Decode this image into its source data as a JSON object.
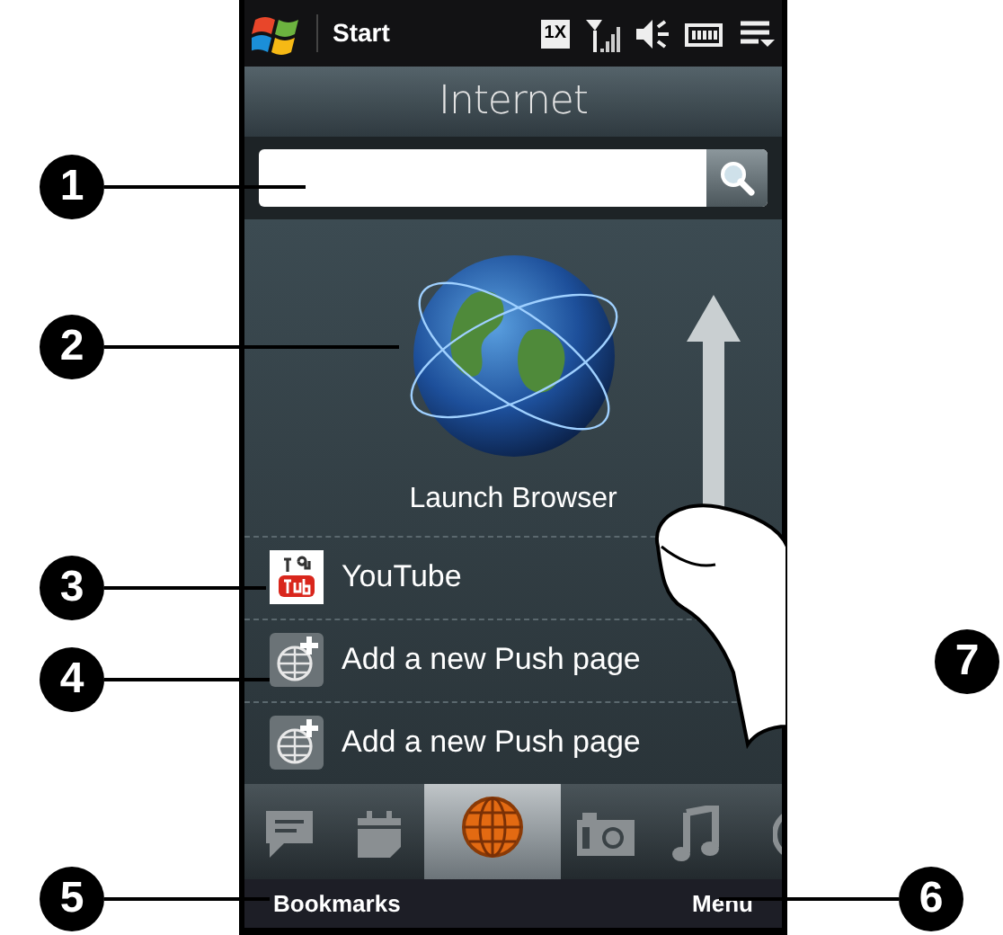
{
  "status_bar": {
    "start_label": "Start",
    "network_badge": "1X"
  },
  "title": "Internet",
  "launcher": {
    "label": "Launch Browser"
  },
  "list": [
    {
      "kind": "youtube",
      "label": "YouTube"
    },
    {
      "kind": "push",
      "label": "Add a new Push page"
    },
    {
      "kind": "push",
      "label": "Add a new Push page"
    }
  ],
  "tabs": [
    {
      "kind": "message",
      "selected": false
    },
    {
      "kind": "calendar",
      "selected": false
    },
    {
      "kind": "internet",
      "selected": true
    },
    {
      "kind": "camera",
      "selected": false
    },
    {
      "kind": "music",
      "selected": false
    },
    {
      "kind": "partial",
      "selected": false
    }
  ],
  "softkeys": {
    "left": "Bookmarks",
    "right": "Menu"
  },
  "callouts": [
    {
      "number": "1"
    },
    {
      "number": "2"
    },
    {
      "number": "3"
    },
    {
      "number": "4"
    },
    {
      "number": "5"
    },
    {
      "number": "6"
    },
    {
      "number": "7"
    }
  ]
}
